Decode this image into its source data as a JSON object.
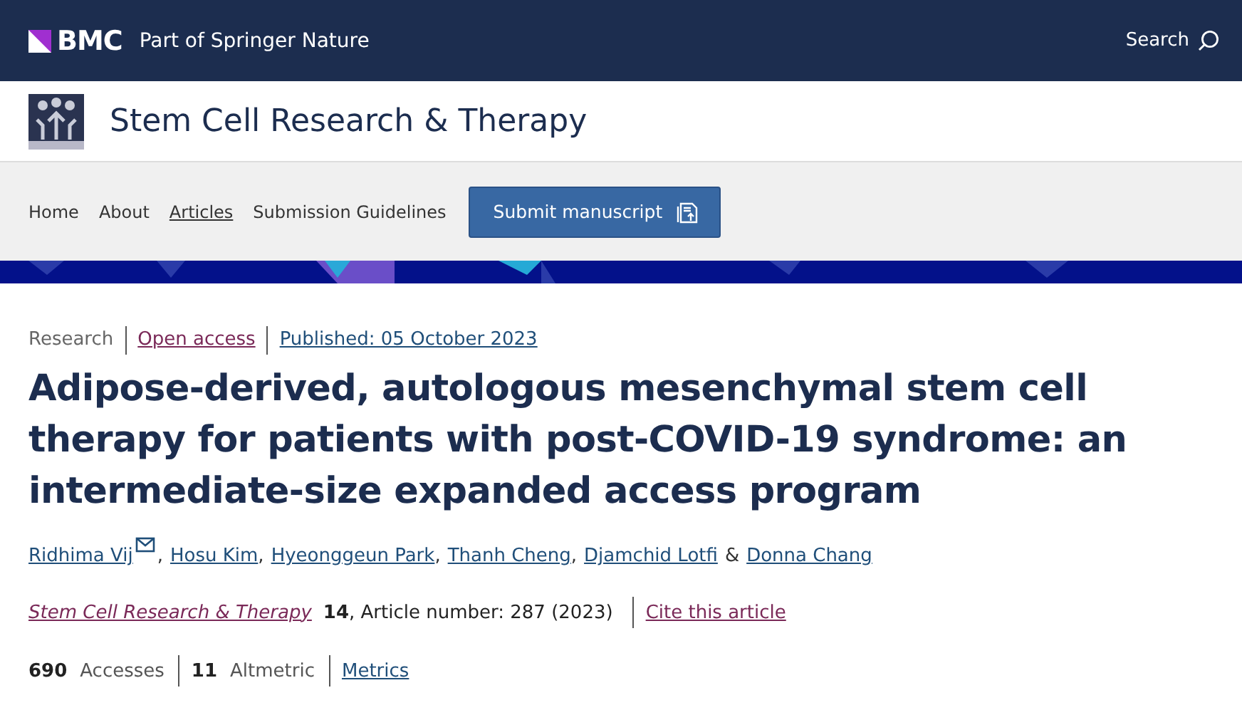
{
  "top_bar": {
    "brand": "BMC",
    "tagline": "Part of Springer Nature",
    "search": "Search"
  },
  "journal": {
    "title": "Stem Cell Research & Therapy"
  },
  "nav": {
    "items": [
      {
        "label": "Home",
        "selected": false
      },
      {
        "label": "About",
        "selected": false
      },
      {
        "label": "Articles",
        "selected": true
      },
      {
        "label": "Submission Guidelines",
        "selected": false
      }
    ],
    "submit": "Submit manuscript"
  },
  "article": {
    "type": "Research",
    "access": "Open access",
    "published": "Published: 05 October 2023",
    "title": "Adipose-derived, autologous mesenchymal stem cell therapy for patients with post-COVID-19 syndrome: an intermediate-size expanded access program",
    "authors": [
      {
        "name": "Ridhima Vij",
        "corresponding": true,
        "sep": ","
      },
      {
        "name": "Hosu Kim",
        "corresponding": false,
        "sep": ","
      },
      {
        "name": "Hyeonggeun Park",
        "corresponding": false,
        "sep": ","
      },
      {
        "name": "Thanh Cheng",
        "corresponding": false,
        "sep": ","
      },
      {
        "name": "Djamchid Lotfi",
        "corresponding": false,
        "sep": "&"
      },
      {
        "name": "Donna Chang",
        "corresponding": false
      }
    ],
    "citation": {
      "journal": "Stem Cell Research & Therapy",
      "volume": "14",
      "details": ", Article number: 287 (2023)",
      "cite": "Cite this article"
    },
    "metrics": [
      {
        "count": "690",
        "label": "Accesses"
      },
      {
        "count": "11",
        "label": "Altmetric"
      }
    ],
    "metrics_link": "Metrics"
  }
}
